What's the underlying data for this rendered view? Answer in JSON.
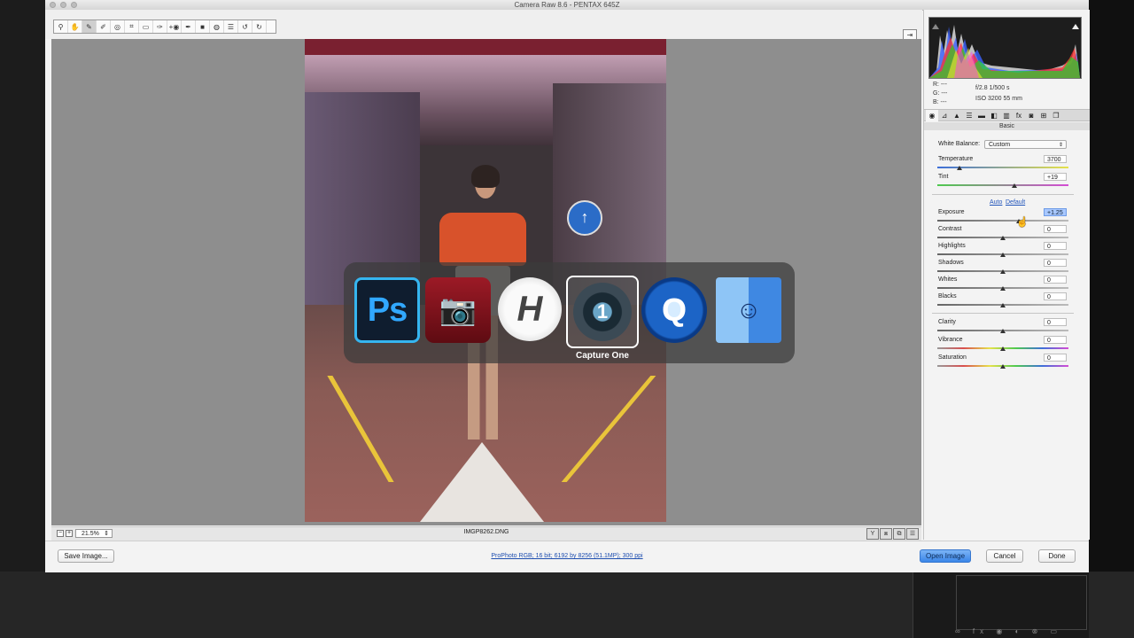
{
  "window": {
    "title": "Camera Raw 8.6  -  PENTAX 645Z"
  },
  "toolbar": {
    "tools": [
      {
        "icon": "zoom-icon",
        "glyph": "⚲"
      },
      {
        "icon": "hand-icon",
        "glyph": "✋"
      },
      {
        "icon": "white-balance-icon",
        "glyph": "✎",
        "selected": true
      },
      {
        "icon": "color-sampler-icon",
        "glyph": "✐"
      },
      {
        "icon": "targeted-adjust-icon",
        "glyph": "◎"
      },
      {
        "icon": "crop-icon",
        "glyph": "⌗"
      },
      {
        "icon": "straighten-icon",
        "glyph": "▭"
      },
      {
        "icon": "spot-removal-icon",
        "glyph": "✑"
      },
      {
        "icon": "red-eye-icon",
        "glyph": "+◉"
      },
      {
        "icon": "adjustment-brush-icon",
        "glyph": "✒"
      },
      {
        "icon": "graduated-filter-icon",
        "glyph": "■"
      },
      {
        "icon": "radial-filter-icon",
        "glyph": "◍"
      },
      {
        "icon": "preferences-icon",
        "glyph": "☰"
      },
      {
        "icon": "rotate-ccw-icon",
        "glyph": "↺"
      },
      {
        "icon": "rotate-cw-icon",
        "glyph": "↻"
      }
    ],
    "compare_glyph": "⇥"
  },
  "switcher": {
    "ps_label": "Ps",
    "hb_label": "H",
    "c1_label": "1",
    "selected_app": "Capture One",
    "qt_label": "Q",
    "finder_label": "☺"
  },
  "statusbar": {
    "zoom_out": "−",
    "zoom_in": "+",
    "zoom_value": "21.5%",
    "filename": "IMGP8262.DNG",
    "view_buttons": [
      "Y",
      "⧈",
      "⧉",
      "☰"
    ]
  },
  "panel": {
    "readout": {
      "r": "R:  ---",
      "g": "G:  ---",
      "b": "B:  ---",
      "aperture_shutter": "f/2.8    1/500 s",
      "iso_focal": "ISO 3200    55 mm"
    },
    "tab_glyphs": [
      "◉",
      "⊿",
      "▲",
      "☰",
      "▬",
      "◧",
      "▥",
      "fx",
      "◙",
      "⊞",
      "❐"
    ],
    "section_title": "Basic",
    "white_balance_label": "White Balance:",
    "white_balance_value": "Custom",
    "auto_label": "Auto",
    "default_label": "Default",
    "sliders": {
      "temperature": {
        "label": "Temperature",
        "value": "3700"
      },
      "tint": {
        "label": "Tint",
        "value": "+19"
      },
      "exposure": {
        "label": "Exposure",
        "value": "+1.25"
      },
      "contrast": {
        "label": "Contrast",
        "value": "0"
      },
      "highlights": {
        "label": "Highlights",
        "value": "0"
      },
      "shadows": {
        "label": "Shadows",
        "value": "0"
      },
      "whites": {
        "label": "Whites",
        "value": "0"
      },
      "blacks": {
        "label": "Blacks",
        "value": "0"
      },
      "clarity": {
        "label": "Clarity",
        "value": "0"
      },
      "vibrance": {
        "label": "Vibrance",
        "value": "0"
      },
      "saturation": {
        "label": "Saturation",
        "value": "0"
      }
    }
  },
  "bottom": {
    "save_label": "Save Image...",
    "workflow_label": "ProPhoto RGB; 16 bit; 6192 by 8256 (51.1MP); 300 ppi",
    "open_label": "Open Image",
    "cancel_label": "Cancel",
    "done_label": "Done"
  },
  "colors": {
    "accent": "#3b86e8",
    "histogram_bg": "#1d1d1d"
  }
}
